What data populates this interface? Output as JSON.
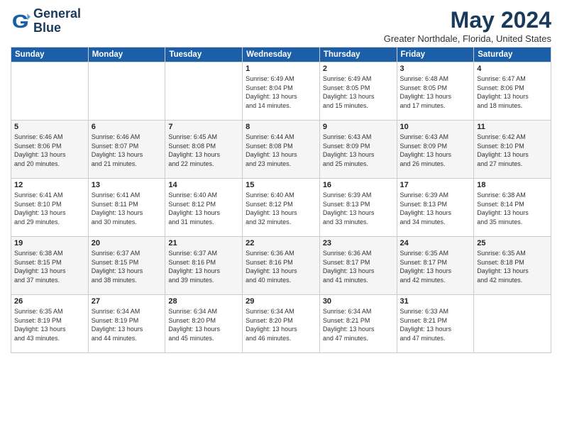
{
  "logo": {
    "line1": "General",
    "line2": "Blue"
  },
  "title": "May 2024",
  "location": "Greater Northdale, Florida, United States",
  "days_of_week": [
    "Sunday",
    "Monday",
    "Tuesday",
    "Wednesday",
    "Thursday",
    "Friday",
    "Saturday"
  ],
  "weeks": [
    [
      {
        "day": "",
        "info": ""
      },
      {
        "day": "",
        "info": ""
      },
      {
        "day": "",
        "info": ""
      },
      {
        "day": "1",
        "info": "Sunrise: 6:49 AM\nSunset: 8:04 PM\nDaylight: 13 hours\nand 14 minutes."
      },
      {
        "day": "2",
        "info": "Sunrise: 6:49 AM\nSunset: 8:05 PM\nDaylight: 13 hours\nand 15 minutes."
      },
      {
        "day": "3",
        "info": "Sunrise: 6:48 AM\nSunset: 8:05 PM\nDaylight: 13 hours\nand 17 minutes."
      },
      {
        "day": "4",
        "info": "Sunrise: 6:47 AM\nSunset: 8:06 PM\nDaylight: 13 hours\nand 18 minutes."
      }
    ],
    [
      {
        "day": "5",
        "info": "Sunrise: 6:46 AM\nSunset: 8:06 PM\nDaylight: 13 hours\nand 20 minutes."
      },
      {
        "day": "6",
        "info": "Sunrise: 6:46 AM\nSunset: 8:07 PM\nDaylight: 13 hours\nand 21 minutes."
      },
      {
        "day": "7",
        "info": "Sunrise: 6:45 AM\nSunset: 8:08 PM\nDaylight: 13 hours\nand 22 minutes."
      },
      {
        "day": "8",
        "info": "Sunrise: 6:44 AM\nSunset: 8:08 PM\nDaylight: 13 hours\nand 23 minutes."
      },
      {
        "day": "9",
        "info": "Sunrise: 6:43 AM\nSunset: 8:09 PM\nDaylight: 13 hours\nand 25 minutes."
      },
      {
        "day": "10",
        "info": "Sunrise: 6:43 AM\nSunset: 8:09 PM\nDaylight: 13 hours\nand 26 minutes."
      },
      {
        "day": "11",
        "info": "Sunrise: 6:42 AM\nSunset: 8:10 PM\nDaylight: 13 hours\nand 27 minutes."
      }
    ],
    [
      {
        "day": "12",
        "info": "Sunrise: 6:41 AM\nSunset: 8:10 PM\nDaylight: 13 hours\nand 29 minutes."
      },
      {
        "day": "13",
        "info": "Sunrise: 6:41 AM\nSunset: 8:11 PM\nDaylight: 13 hours\nand 30 minutes."
      },
      {
        "day": "14",
        "info": "Sunrise: 6:40 AM\nSunset: 8:12 PM\nDaylight: 13 hours\nand 31 minutes."
      },
      {
        "day": "15",
        "info": "Sunrise: 6:40 AM\nSunset: 8:12 PM\nDaylight: 13 hours\nand 32 minutes."
      },
      {
        "day": "16",
        "info": "Sunrise: 6:39 AM\nSunset: 8:13 PM\nDaylight: 13 hours\nand 33 minutes."
      },
      {
        "day": "17",
        "info": "Sunrise: 6:39 AM\nSunset: 8:13 PM\nDaylight: 13 hours\nand 34 minutes."
      },
      {
        "day": "18",
        "info": "Sunrise: 6:38 AM\nSunset: 8:14 PM\nDaylight: 13 hours\nand 35 minutes."
      }
    ],
    [
      {
        "day": "19",
        "info": "Sunrise: 6:38 AM\nSunset: 8:15 PM\nDaylight: 13 hours\nand 37 minutes."
      },
      {
        "day": "20",
        "info": "Sunrise: 6:37 AM\nSunset: 8:15 PM\nDaylight: 13 hours\nand 38 minutes."
      },
      {
        "day": "21",
        "info": "Sunrise: 6:37 AM\nSunset: 8:16 PM\nDaylight: 13 hours\nand 39 minutes."
      },
      {
        "day": "22",
        "info": "Sunrise: 6:36 AM\nSunset: 8:16 PM\nDaylight: 13 hours\nand 40 minutes."
      },
      {
        "day": "23",
        "info": "Sunrise: 6:36 AM\nSunset: 8:17 PM\nDaylight: 13 hours\nand 41 minutes."
      },
      {
        "day": "24",
        "info": "Sunrise: 6:35 AM\nSunset: 8:17 PM\nDaylight: 13 hours\nand 42 minutes."
      },
      {
        "day": "25",
        "info": "Sunrise: 6:35 AM\nSunset: 8:18 PM\nDaylight: 13 hours\nand 42 minutes."
      }
    ],
    [
      {
        "day": "26",
        "info": "Sunrise: 6:35 AM\nSunset: 8:19 PM\nDaylight: 13 hours\nand 43 minutes."
      },
      {
        "day": "27",
        "info": "Sunrise: 6:34 AM\nSunset: 8:19 PM\nDaylight: 13 hours\nand 44 minutes."
      },
      {
        "day": "28",
        "info": "Sunrise: 6:34 AM\nSunset: 8:20 PM\nDaylight: 13 hours\nand 45 minutes."
      },
      {
        "day": "29",
        "info": "Sunrise: 6:34 AM\nSunset: 8:20 PM\nDaylight: 13 hours\nand 46 minutes."
      },
      {
        "day": "30",
        "info": "Sunrise: 6:34 AM\nSunset: 8:21 PM\nDaylight: 13 hours\nand 47 minutes."
      },
      {
        "day": "31",
        "info": "Sunrise: 6:33 AM\nSunset: 8:21 PM\nDaylight: 13 hours\nand 47 minutes."
      },
      {
        "day": "",
        "info": ""
      }
    ]
  ]
}
